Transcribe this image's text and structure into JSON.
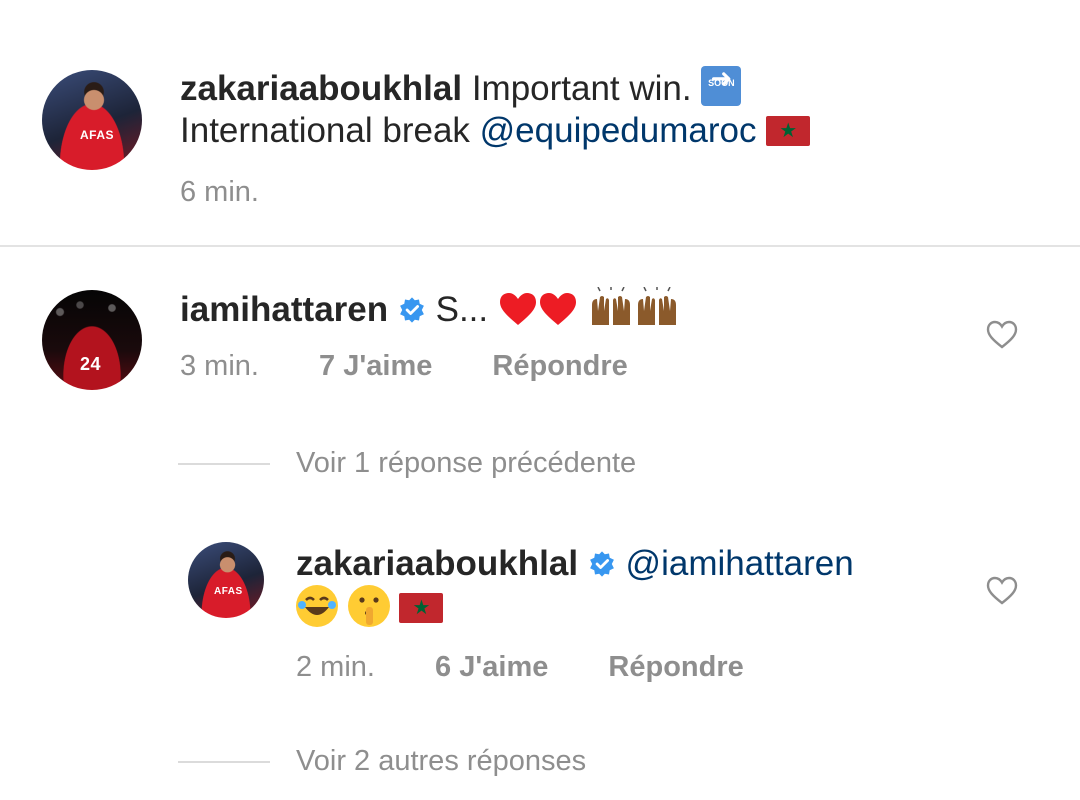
{
  "post": {
    "username": "zakariaaboukhlal",
    "text_line1": "Important win.",
    "soon_label": "SOON",
    "text_line2_prefix": "International break",
    "mention": "@equipedumaroc",
    "time": "6 min.",
    "avatar_text": "AFAS"
  },
  "comment": {
    "username": "iamihattaren",
    "text": "S...",
    "time": "3 min.",
    "likes": "7 J'aime",
    "reply": "Répondre",
    "avatar_text": "24"
  },
  "view_previous": "Voir 1 réponse précédente",
  "reply": {
    "username": "zakariaaboukhlal",
    "mention": "@iamihattaren",
    "time": "2 min.",
    "likes": "6 J'aime",
    "reply": "Répondre",
    "avatar_text": "AFAS"
  },
  "view_more": "Voir 2 autres réponses",
  "colors": {
    "text": "#262626",
    "muted": "#8e8e8e",
    "mention": "#00376b",
    "verified": "#3897f0",
    "heart": "#ed1c24",
    "flag": "#c1272d"
  }
}
